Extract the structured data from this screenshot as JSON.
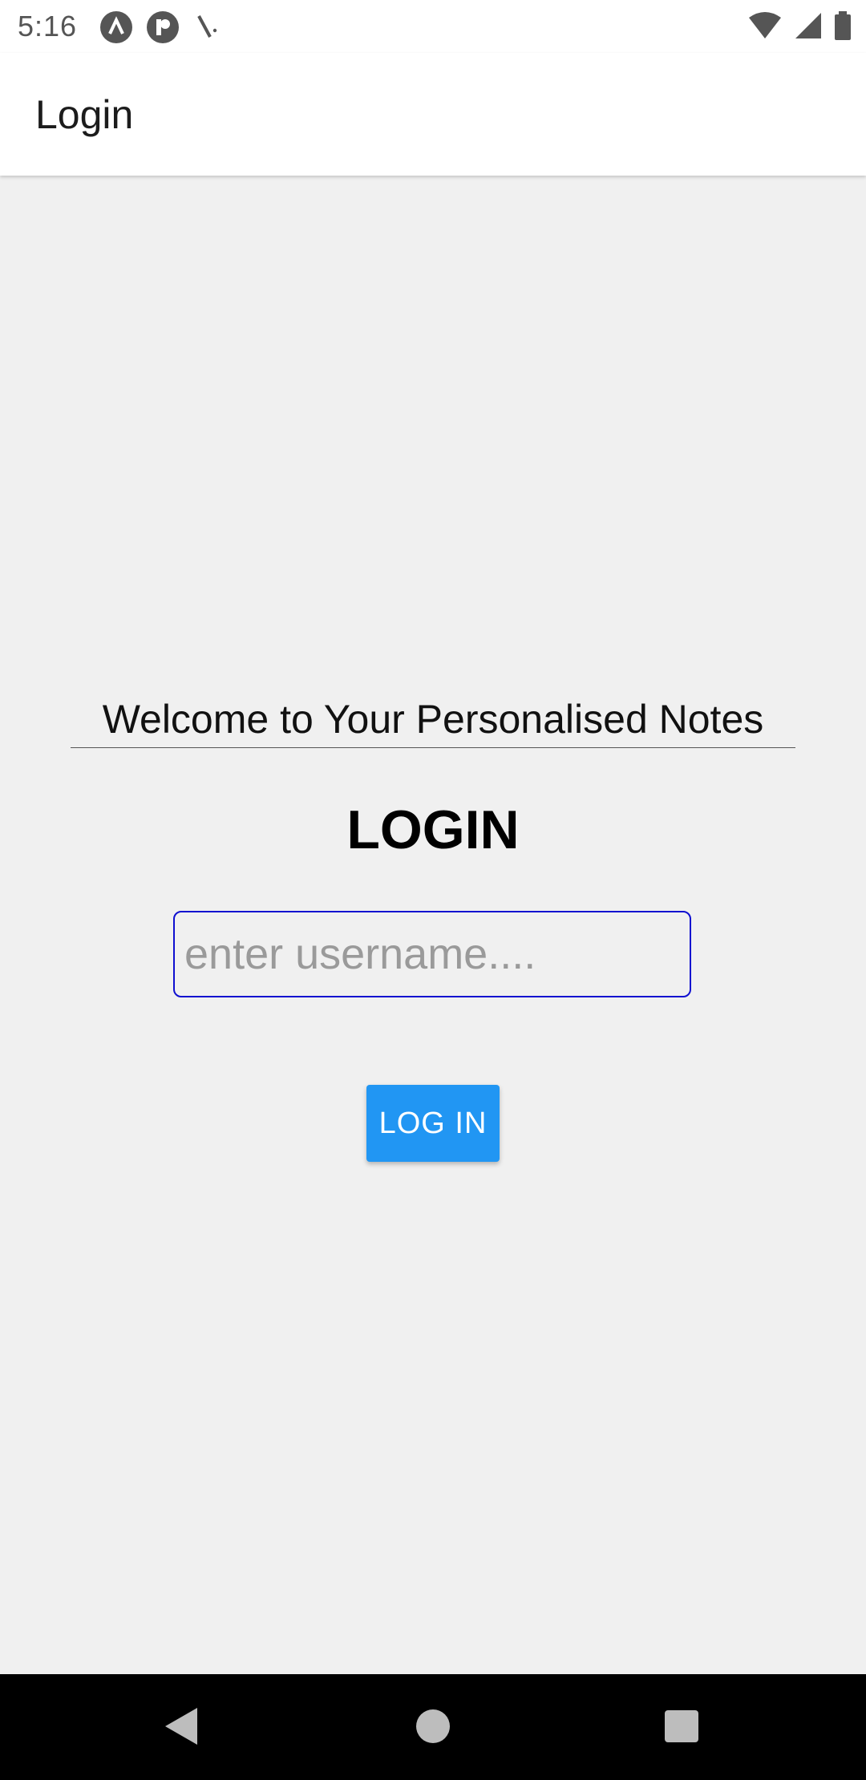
{
  "status_bar": {
    "time": "5:16",
    "left_icons": [
      "app-a-icon",
      "app-p-icon",
      "debug-icon"
    ],
    "right_icons": [
      "wifi-icon",
      "cell-signal-icon",
      "battery-icon"
    ]
  },
  "app_bar": {
    "title": "Login"
  },
  "main": {
    "welcome_text": "Welcome to Your Personalised Notes",
    "heading": "LOGIN",
    "username_placeholder": "enter username....",
    "username_value": "",
    "login_button_label": "LOG IN"
  },
  "nav_bar": {
    "icons": [
      "back-icon",
      "home-icon",
      "recents-icon"
    ]
  },
  "colors": {
    "accent": "#2196f3",
    "input_border": "#1010d0",
    "background": "#f0f0f0"
  }
}
